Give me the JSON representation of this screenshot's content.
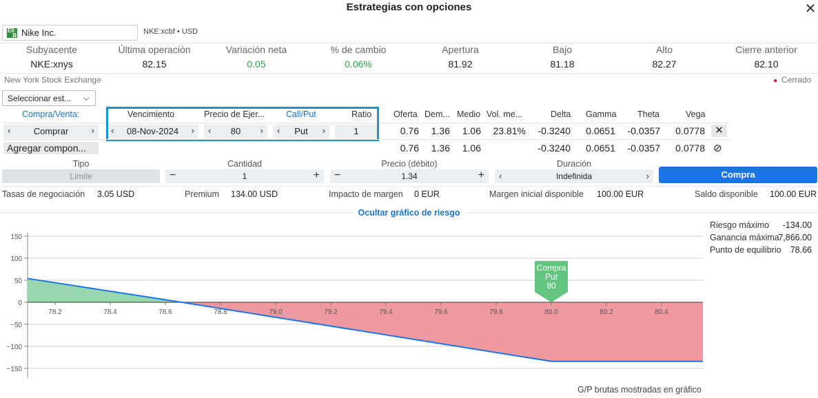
{
  "window": {
    "title": "Estrategias con opciones"
  },
  "symbol": {
    "name": "Nike Inc.",
    "exchange_code": "NKE:xcbf • USD",
    "logo_text_1": "E0",
    "logo_text_2": "B"
  },
  "stats": [
    {
      "label": "Subyacente",
      "value": "NKE:xnys"
    },
    {
      "label": "Última operación",
      "value": "82.15"
    },
    {
      "label": "Variación neta",
      "value": "0.05"
    },
    {
      "label": "% de cambio",
      "value": "0.06%"
    },
    {
      "label": "Apertura",
      "value": "81.92"
    },
    {
      "label": "Bajo",
      "value": "81.18"
    },
    {
      "label": "Alto",
      "value": "82.27"
    },
    {
      "label": "Cierre anterior",
      "value": "82.10"
    }
  ],
  "exchange_name": "New York Stock Exchange",
  "market_status": "Cerrado",
  "strategy_select": "Seleccionar est...",
  "legs_header": {
    "side": "Compra/Venta:",
    "expiry": "Vencimiento",
    "strike": "Precio de Ejer...",
    "callput": "Call/Put",
    "ratio": "Ratio",
    "bid": "Oferta",
    "ask": "Dem...",
    "mid": "Medio",
    "vol": "Vol. me...",
    "delta": "Delta",
    "gamma": "Gamma",
    "theta": "Theta",
    "vega": "Vega"
  },
  "leg": {
    "side": "Comprar",
    "expiry": "08-Nov-2024",
    "strike": "80",
    "callput": "Put",
    "ratio": "1",
    "bid": "0.76",
    "ask": "1.36",
    "mid": "1.06",
    "vol": "23.81%",
    "delta": "-0.3240",
    "gamma": "0.0651",
    "theta": "-0.0357",
    "vega": "0.0778"
  },
  "totals": {
    "bid": "0.76",
    "ask": "1.36",
    "mid": "1.06",
    "delta": "-0.3240",
    "gamma": "0.0651",
    "theta": "-0.0357",
    "vega": "0.0778"
  },
  "add_component": "Agregar compon...",
  "order": {
    "type_label": "Tipo",
    "type_value": "Límite",
    "qty_label": "Cantidad",
    "qty_value": "1",
    "price_label": "Precio (débito)",
    "price_value": "1.34",
    "duration_label": "Duración",
    "duration_value": "Indefinida",
    "buy_button": "Compra"
  },
  "footer": {
    "fees_label": "Tasas de negociación",
    "fees_value": "3.05 USD",
    "premium_label": "Premium",
    "premium_value": "134.00 USD",
    "margin_impact_label": "Impacto de margen",
    "margin_impact_value": "0 EUR",
    "init_margin_label": "Margen inicial disponible",
    "init_margin_value": "100.00 EUR",
    "balance_label": "Saldo disponible",
    "balance_value": "100.00 EUR"
  },
  "hide_risk": "Ocultar gráfico de riesgo",
  "risk": {
    "max_risk_label": "Riesgo máximo",
    "max_risk_value": "-134.00",
    "max_gain_label": "Ganancia máxima",
    "max_gain_value": "7,866.00",
    "breakeven_label": "Punto de equilibrio",
    "breakeven_value": "78.66"
  },
  "chart_note": "G/P brutas mostradas en gráfico",
  "colors": {
    "profit": "#98d6ae",
    "loss": "#ef9aa0",
    "line": "#1a73e8",
    "marker": "#62c47f"
  },
  "chart_data": {
    "type": "area",
    "x": [
      78.1,
      78.66,
      80.0,
      80.55
    ],
    "y": [
      54,
      0,
      -134,
      -134
    ],
    "xticks": [
      "78.2",
      "78.4",
      "78.6",
      "78.8",
      "79.0",
      "79.2",
      "79.4",
      "79.6",
      "79.8",
      "80.0",
      "80.2",
      "80.4"
    ],
    "yticks": [
      "150",
      "100",
      "50",
      "0",
      "−50",
      "−100",
      "−150"
    ],
    "xlim": [
      78.1,
      80.55
    ],
    "ylim": [
      -150,
      150
    ],
    "marker": {
      "x": 80.0,
      "lines": [
        "Compra",
        "Put",
        "80"
      ]
    }
  }
}
